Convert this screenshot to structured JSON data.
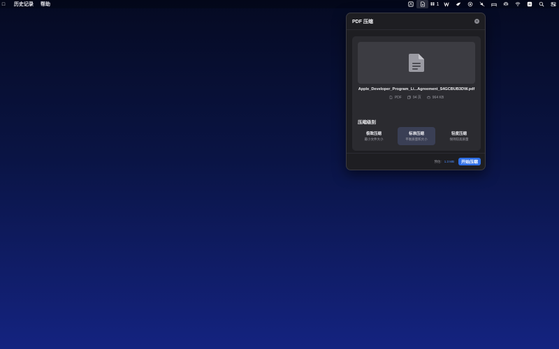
{
  "menubar": {
    "apple_glyph": "□",
    "items": [
      "历史记录",
      "帮助"
    ],
    "tray": {
      "badge_count": "1",
      "icons": [
        "app-icon-a",
        "pdf-compress-icon",
        "dropbox-icon",
        "app-icon-m",
        "app-icon-bird",
        "copilot-icon",
        "mute-icon",
        "bed-icon",
        "airdrop-icon",
        "wifi-icon",
        "app-icon-s",
        "search-icon",
        "control-center-icon"
      ]
    }
  },
  "popover": {
    "title": "PDF 压缩",
    "file": {
      "name": "Apple_Developer_Program_Li...Agreement_S4GCBUB3DW.pdf",
      "type": "PDF",
      "pages": "94 页",
      "size": "964 KB"
    },
    "level": {
      "title": "压缩级别",
      "options": [
        {
          "label": "极致压缩",
          "desc": "最小文件大小"
        },
        {
          "label": "标准压缩",
          "desc": "平衡质量和大小"
        },
        {
          "label": "轻度压缩",
          "desc": "保持较高质量"
        }
      ],
      "selected_index": 1
    },
    "footer": {
      "estimate_label": "预估:",
      "estimate_value": "1.3 MB",
      "start_label": "开始压缩"
    }
  },
  "colors": {
    "accent": "#2f6fe6",
    "estimate": "#4c8dff",
    "panel": "#1e1e22",
    "card": "#2b2b30"
  }
}
